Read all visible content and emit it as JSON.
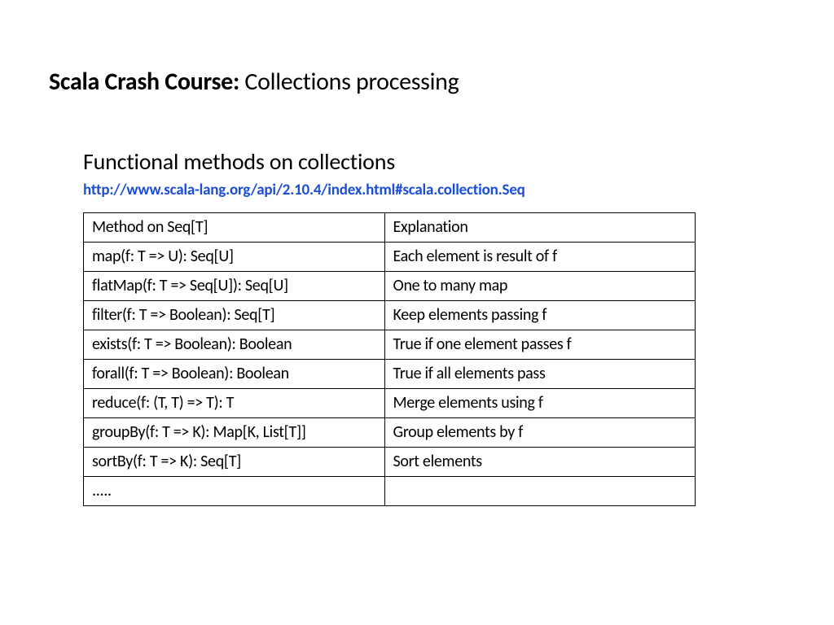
{
  "title": {
    "bold": "Scala Crash Course:",
    "rest": " Collections processing"
  },
  "section_heading": "Functional methods on collections",
  "link_text": "http://www.scala-lang.org/api/2.10.4/index.html#scala.collection.Seq",
  "table": {
    "header": {
      "method": "Method on Seq[T]",
      "explanation": "Explanation"
    },
    "rows": [
      {
        "method": "map(f: T => U): Seq[U]",
        "explanation": "Each element is result of f"
      },
      {
        "method": "flatMap(f: T => Seq[U]): Seq[U]",
        "explanation": "One to many map"
      },
      {
        "method": "filter(f: T => Boolean): Seq[T]",
        "explanation": "Keep elements passing f"
      },
      {
        "method": "exists(f: T => Boolean): Boolean",
        "explanation": "True if one element passes f"
      },
      {
        "method": "forall(f: T => Boolean): Boolean",
        "explanation": "True if all elements pass"
      },
      {
        "method": "reduce(f: (T, T) => T): T",
        "explanation": "Merge elements using f"
      },
      {
        "method": "groupBy(f: T => K): Map[K, List[T]]",
        "explanation": "Group elements by f"
      },
      {
        "method": "sortBy(f: T => K): Seq[T]",
        "explanation": "Sort elements"
      },
      {
        "method": ".....",
        "explanation": ""
      }
    ]
  }
}
